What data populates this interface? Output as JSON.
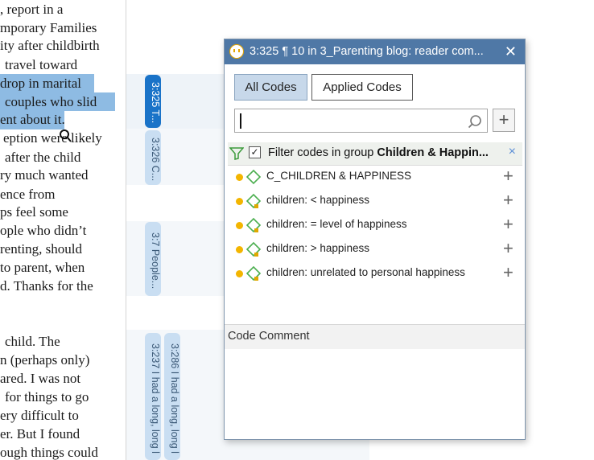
{
  "document": {
    "lines": [
      ", report in a",
      "mporary Families",
      "ity after childbirth",
      "travel toward",
      "drop in marital",
      "couples who slid",
      "ent about it.",
      "eption were likely",
      "after the child",
      "ry much wanted",
      "ence from",
      "ps feel some",
      "ople who didn’t",
      "renting, should",
      "to parent, when",
      "d. Thanks for the",
      "",
      "",
      "child. The",
      "n (perhaps only)",
      "ared. I was not",
      "for things to go",
      "ery difficult to",
      "er. But I found",
      "ough things could"
    ]
  },
  "margin": {
    "tags": [
      {
        "label": "3:325 T..."
      },
      {
        "label": "3:326 C..."
      },
      {
        "label": "3:7 People..."
      },
      {
        "label": "3:237 I had a long, long l"
      },
      {
        "label": "3:286 I had a long, long l"
      }
    ]
  },
  "popup": {
    "title": "3:325 ¶ 10 in 3_Parenting blog: reader com...",
    "tabs": {
      "all": "All Codes",
      "applied": "Applied Codes"
    },
    "search": {
      "value": "",
      "placeholder": ""
    },
    "filter": {
      "prefix": "Filter codes in group ",
      "group": "Children & Happin...",
      "checked": "✓"
    },
    "codes": [
      {
        "label": "C_CHILDREN & HAPPINESS"
      },
      {
        "label": "children: < happiness"
      },
      {
        "label": "children: = level of happiness"
      },
      {
        "label": "children: > happiness"
      },
      {
        "label": "children: unrelated to personal happiness"
      }
    ],
    "comment_header": "Code Comment",
    "close": "✕",
    "add": "+",
    "filter_clear": "×",
    "row_add": "+"
  },
  "colors": {
    "titlebar": "#4f78a6",
    "highlight": "#8ebbe3",
    "code_dot": "#f3b500",
    "code_diamond": "#4caf50",
    "active_tag": "#1a73c8"
  }
}
